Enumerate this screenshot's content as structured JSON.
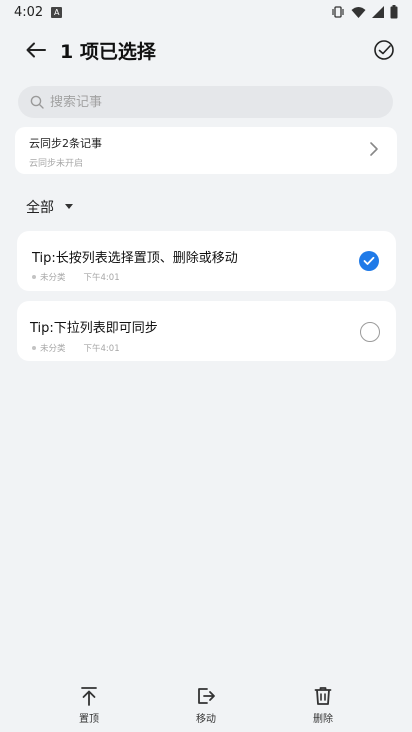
{
  "status": {
    "time": "4:02"
  },
  "header": {
    "title": "1 项已选择"
  },
  "search": {
    "placeholder": "搜索记事"
  },
  "cloud_sync": {
    "title": "云同步2条记事",
    "subtitle": "云同步未开启"
  },
  "filter": {
    "label": "全部"
  },
  "notes": [
    {
      "title": "Tip:长按列表选择置顶、删除或移动",
      "category": "未分类",
      "time": "下午4:01",
      "selected": true
    },
    {
      "title": "Tip:下拉列表即可同步",
      "category": "未分类",
      "time": "下午4:01",
      "selected": false
    }
  ],
  "bottom_bar": {
    "pin_label": "置顶",
    "move_label": "移动",
    "delete_label": "删除"
  },
  "colors": {
    "accent": "#1f7ae8",
    "background": "#f1f3f5"
  }
}
